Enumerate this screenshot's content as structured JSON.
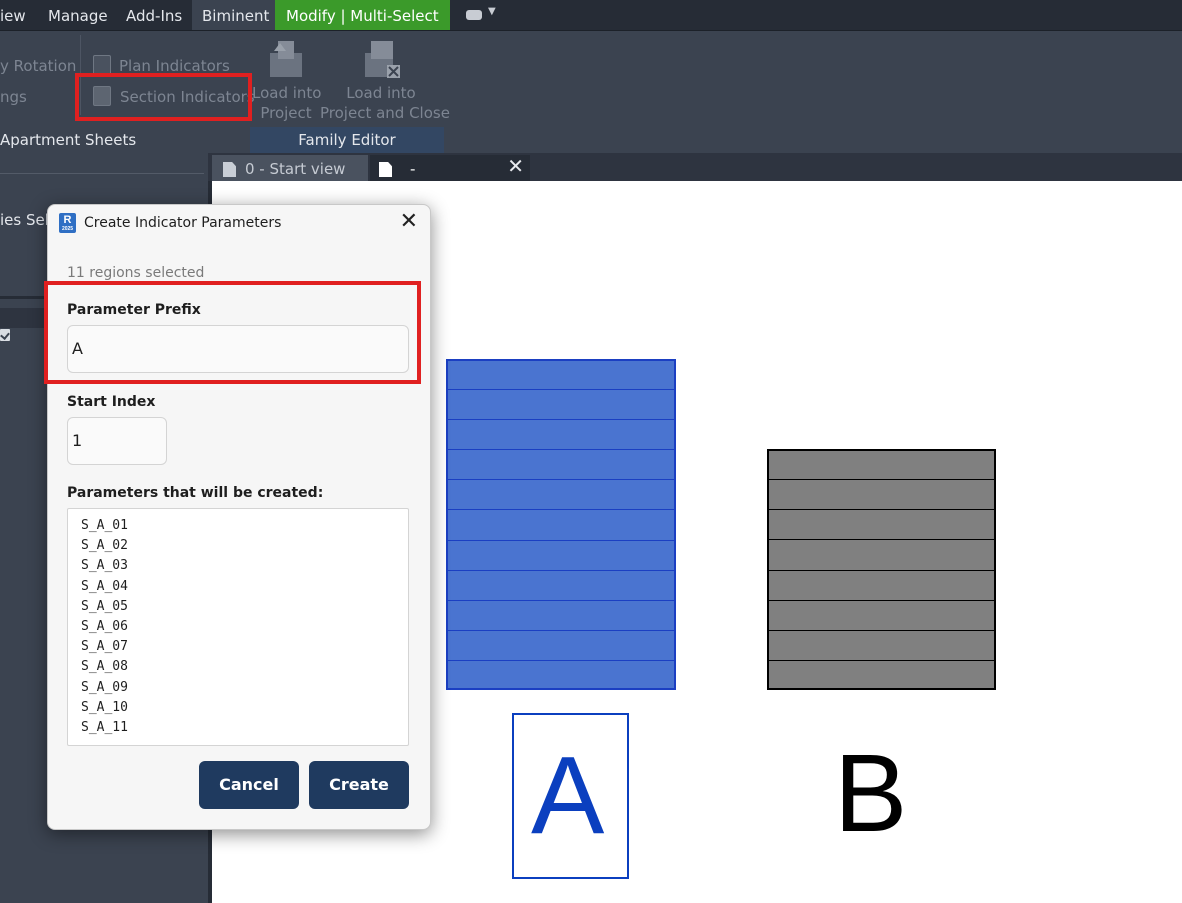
{
  "ribbon_tabs": [
    {
      "label": "iew"
    },
    {
      "label": "Manage"
    },
    {
      "label": "Add-Ins"
    },
    {
      "label": "Biminent"
    },
    {
      "label": "Modify | Multi-Select"
    }
  ],
  "ribbon": {
    "rotation_label": "y Rotation",
    "settings_label": "ngs",
    "plan_indicators": "Plan Indicators",
    "section_indicators": "Section Indicators",
    "load_into_project": [
      "Load into",
      "Project"
    ],
    "load_into_project_close": [
      "Load into",
      "Project and Close"
    ],
    "panel_apartment": "Apartment Sheets",
    "panel_family_editor": "Family Editor"
  },
  "left_panel": {
    "partial_text": "ies Sele"
  },
  "view_tabs": [
    {
      "label": "0 - Start view"
    },
    {
      "label": "-"
    }
  ],
  "canvas": {
    "region_a": {
      "band_count": 11,
      "fill": "#4a74d0",
      "stroke": "#1b3fc2"
    },
    "region_b": {
      "band_count": 8,
      "fill": "#808080",
      "stroke": "#000000"
    },
    "letter_a": "A",
    "letter_b": "B",
    "letter_a_color": "#0b3fbf"
  },
  "dialog": {
    "title": "Create Indicator Parameters",
    "regions_selected": "11 regions selected",
    "prefix_label": "Parameter Prefix",
    "prefix_value": "A",
    "start_index_label": "Start Index",
    "start_index_value": "1",
    "params_label": "Parameters that will be created:",
    "params": [
      "S_A_01",
      "S_A_02",
      "S_A_03",
      "S_A_04",
      "S_A_05",
      "S_A_06",
      "S_A_07",
      "S_A_08",
      "S_A_09",
      "S_A_10",
      "S_A_11"
    ],
    "cancel_label": "Cancel",
    "create_label": "Create"
  },
  "colors": {
    "highlight_red": "#e02020",
    "modify_tab_green": "#3b9a2a",
    "button_navy": "#1f3a5f"
  }
}
